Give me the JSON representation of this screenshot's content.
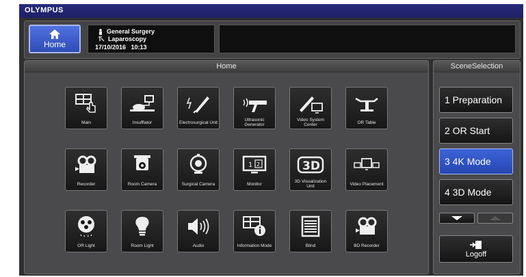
{
  "brand": "OLYMPUS",
  "figure_code": "16117",
  "header": {
    "home_label": "Home",
    "department": "General Surgery",
    "procedure": "Laparoscopy",
    "datetime": "17/10/2016   10:13"
  },
  "home_panel": {
    "title": "Home",
    "tiles": [
      {
        "label": "Main",
        "icon": "grid-hand-icon"
      },
      {
        "label": "Insufflator",
        "icon": "insufflator-icon"
      },
      {
        "label": "Electrosurgical Unit",
        "icon": "electrosurgical-icon"
      },
      {
        "label": "Ultrasonic Generator",
        "icon": "ultrasonic-icon"
      },
      {
        "label": "Video System Center",
        "icon": "video-system-icon"
      },
      {
        "label": "OR Table",
        "icon": "or-table-icon"
      },
      {
        "label": "Recorder",
        "icon": "recorder-icon"
      },
      {
        "label": "Room Camera",
        "icon": "room-camera-icon"
      },
      {
        "label": "Surgical Camera",
        "icon": "surgical-camera-icon"
      },
      {
        "label": "Monitor",
        "icon": "monitor-icon"
      },
      {
        "label": "3D Visualization Unit",
        "icon": "3d-icon"
      },
      {
        "label": "Video Placement",
        "icon": "video-placement-icon"
      },
      {
        "label": "OR Light",
        "icon": "or-light-icon"
      },
      {
        "label": "Room Light",
        "icon": "bulb-icon"
      },
      {
        "label": "Audio",
        "icon": "speaker-icon"
      },
      {
        "label": "Information Mode",
        "icon": "info-icon"
      },
      {
        "label": "Blind",
        "icon": "blind-icon"
      },
      {
        "label": "BD Recorder",
        "icon": "bd-recorder-icon"
      }
    ],
    "monitor_icon_text": "1 2",
    "three_d_icon_text": "3D"
  },
  "scene_panel": {
    "title": "SceneSelection",
    "scenes": [
      "1 Preparation",
      "2 OR Start",
      "3 4K Mode",
      "4 3D Mode"
    ],
    "active_scene": "3 4K Mode",
    "logoff_label": "Logoff"
  },
  "colors": {
    "brand_bar": "#262a78",
    "active_blue": "#3c63d8",
    "panel_bg": "#4a4a4c"
  }
}
